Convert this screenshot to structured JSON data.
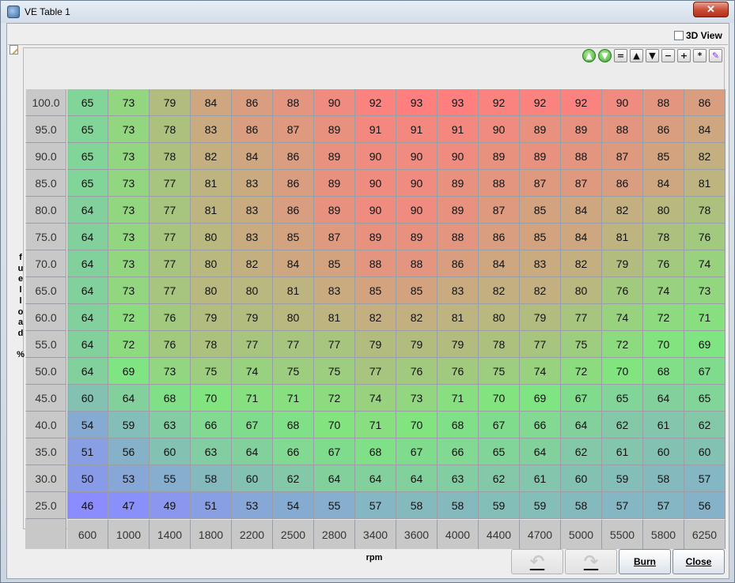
{
  "window": {
    "title": "VE Table 1",
    "close_glyph": "✕"
  },
  "view3d": {
    "label": "3D View",
    "checked": false
  },
  "toolbar": [
    {
      "icon": "arrow-up-circle-icon",
      "glyph": "▲",
      "style": "green"
    },
    {
      "icon": "arrow-down-circle-icon",
      "glyph": "▼",
      "style": "green"
    },
    {
      "icon": "equals-icon",
      "glyph": "=",
      "style": ""
    },
    {
      "icon": "triangle-up-icon",
      "glyph": "▲",
      "style": ""
    },
    {
      "icon": "triangle-down-icon",
      "glyph": "▼",
      "style": ""
    },
    {
      "icon": "minus-icon",
      "glyph": "−",
      "style": ""
    },
    {
      "icon": "plus-icon",
      "glyph": "+",
      "style": ""
    },
    {
      "icon": "multiply-icon",
      "glyph": "*",
      "style": ""
    },
    {
      "icon": "pen-icon",
      "glyph": "✎",
      "style": "pen"
    }
  ],
  "y_axis_label": [
    "f",
    "u",
    "e",
    "l",
    "l",
    "o",
    "a",
    "d",
    "",
    "%"
  ],
  "x_axis_label": "rpm",
  "load_bins": [
    "100.0",
    "95.0",
    "90.0",
    "85.0",
    "80.0",
    "75.0",
    "70.0",
    "65.0",
    "60.0",
    "55.0",
    "50.0",
    "45.0",
    "40.0",
    "35.0",
    "30.0",
    "25.0"
  ],
  "rpm_bins": [
    "600",
    "1000",
    "1400",
    "1800",
    "2200",
    "2500",
    "2800",
    "3400",
    "3600",
    "4000",
    "4400",
    "4700",
    "5000",
    "5500",
    "5800",
    "6250"
  ],
  "table": [
    [
      65,
      73,
      79,
      84,
      86,
      88,
      90,
      92,
      93,
      93,
      92,
      92,
      92,
      90,
      88,
      86
    ],
    [
      65,
      73,
      78,
      83,
      86,
      87,
      89,
      91,
      91,
      91,
      90,
      89,
      89,
      88,
      86,
      84
    ],
    [
      65,
      73,
      78,
      82,
      84,
      86,
      89,
      90,
      90,
      90,
      89,
      89,
      88,
      87,
      85,
      82
    ],
    [
      65,
      73,
      77,
      81,
      83,
      86,
      89,
      90,
      90,
      89,
      88,
      87,
      87,
      86,
      84,
      81
    ],
    [
      64,
      73,
      77,
      81,
      83,
      86,
      89,
      90,
      90,
      89,
      87,
      85,
      84,
      82,
      80,
      78
    ],
    [
      64,
      73,
      77,
      80,
      83,
      85,
      87,
      89,
      89,
      88,
      86,
      85,
      84,
      81,
      78,
      76
    ],
    [
      64,
      73,
      77,
      80,
      82,
      84,
      85,
      88,
      88,
      86,
      84,
      83,
      82,
      79,
      76,
      74
    ],
    [
      64,
      73,
      77,
      80,
      80,
      81,
      83,
      85,
      85,
      83,
      82,
      82,
      80,
      76,
      74,
      73
    ],
    [
      64,
      72,
      76,
      79,
      79,
      80,
      81,
      82,
      82,
      81,
      80,
      79,
      77,
      74,
      72,
      71
    ],
    [
      64,
      72,
      76,
      78,
      77,
      77,
      77,
      79,
      79,
      79,
      78,
      77,
      75,
      72,
      70,
      69
    ],
    [
      64,
      69,
      73,
      75,
      74,
      75,
      75,
      77,
      76,
      76,
      75,
      74,
      72,
      70,
      68,
      67
    ],
    [
      60,
      64,
      68,
      70,
      71,
      71,
      72,
      74,
      73,
      71,
      70,
      69,
      67,
      65,
      64,
      65
    ],
    [
      54,
      59,
      63,
      66,
      67,
      68,
      70,
      71,
      70,
      68,
      67,
      66,
      64,
      62,
      61,
      62
    ],
    [
      51,
      56,
      60,
      63,
      64,
      66,
      67,
      68,
      67,
      66,
      65,
      64,
      62,
      61,
      60,
      60
    ],
    [
      50,
      53,
      55,
      58,
      60,
      62,
      64,
      64,
      64,
      63,
      62,
      61,
      60,
      59,
      58,
      57
    ],
    [
      46,
      47,
      49,
      51,
      53,
      54,
      55,
      57,
      58,
      58,
      59,
      59,
      58,
      57,
      57,
      56
    ]
  ],
  "colors": {
    "low": "#8a8cff",
    "mid": "#7fe67f",
    "high": "#ff7f7f"
  },
  "buttons": {
    "undo": "↶",
    "redo": "↷",
    "burn": "Burn",
    "close": "Close"
  }
}
